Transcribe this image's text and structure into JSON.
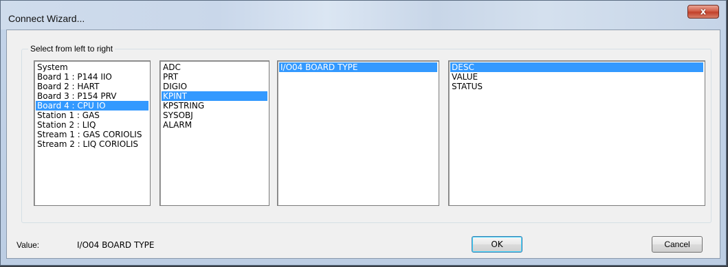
{
  "window": {
    "title": "Connect Wizard...",
    "close_glyph": "x"
  },
  "group": {
    "label": "Select from left to right"
  },
  "lists": {
    "sources": {
      "items": [
        "System",
        "Board 1 : P144 IIO",
        "Board 2 : HART",
        "Board 3 : P154 PRV",
        "Board 4 : CPU IO",
        "Station 1 : GAS",
        "Station 2 : LIQ",
        "Stream 1 : GAS CORIOLIS",
        "Stream 2 : LIQ CORIOLIS"
      ],
      "selected": "Board 4 : CPU IO"
    },
    "types": {
      "items": [
        "ADC",
        "PRT",
        "DIGIO",
        "KPINT",
        "KPSTRING",
        "SYSOBJ",
        "ALARM"
      ],
      "selected": "KPINT"
    },
    "points": {
      "items": [
        "I/O04 BOARD TYPE"
      ],
      "selected": "I/O04 BOARD TYPE"
    },
    "fields": {
      "items": [
        "DESC",
        "VALUE",
        "STATUS"
      ],
      "selected": "DESC"
    }
  },
  "footer": {
    "value_label": "Value:",
    "value_text": "I/O04 BOARD TYPE",
    "ok_label": "OK",
    "cancel_label": "Cancel"
  },
  "colors": {
    "selection": "#3399ff",
    "close_button": "#c2402a"
  }
}
